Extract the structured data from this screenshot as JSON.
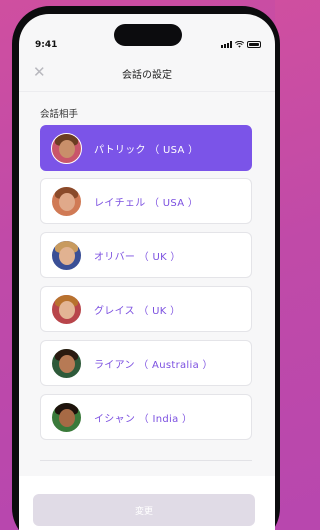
{
  "status_bar": {
    "time": "9:41"
  },
  "header": {
    "close_icon": "close-icon",
    "title": "会話の設定"
  },
  "section": {
    "label": "会話相手"
  },
  "partners": [
    {
      "name": "パトリック （ USA ）",
      "selected": true,
      "skin": "#c98f6a",
      "hair": "#6b3d22",
      "bg": "#c9556a"
    },
    {
      "name": "レイチェル （ USA ）",
      "selected": false,
      "skin": "#e0a98a",
      "hair": "#8a4a2a",
      "bg": "#d07a55"
    },
    {
      "name": "オリバー （ UK ）",
      "selected": false,
      "skin": "#e1b291",
      "hair": "#c89a5e",
      "bg": "#3a4f96"
    },
    {
      "name": "グレイス （ UK ）",
      "selected": false,
      "skin": "#e3b595",
      "hair": "#b8722e",
      "bg": "#b8454a"
    },
    {
      "name": "ライアン （ Australia ）",
      "selected": false,
      "skin": "#b77a55",
      "hair": "#2a1a10",
      "bg": "#2e5a3a"
    },
    {
      "name": "イシャン （ India ）",
      "selected": false,
      "skin": "#a76a45",
      "hair": "#1e130c",
      "bg": "#3a7a3a"
    }
  ],
  "footer": {
    "button_label": "変更"
  },
  "colors": {
    "accent": "#7b54e8",
    "accent_text": "#7b4fe0",
    "disabled_button": "#e0dbe6"
  }
}
